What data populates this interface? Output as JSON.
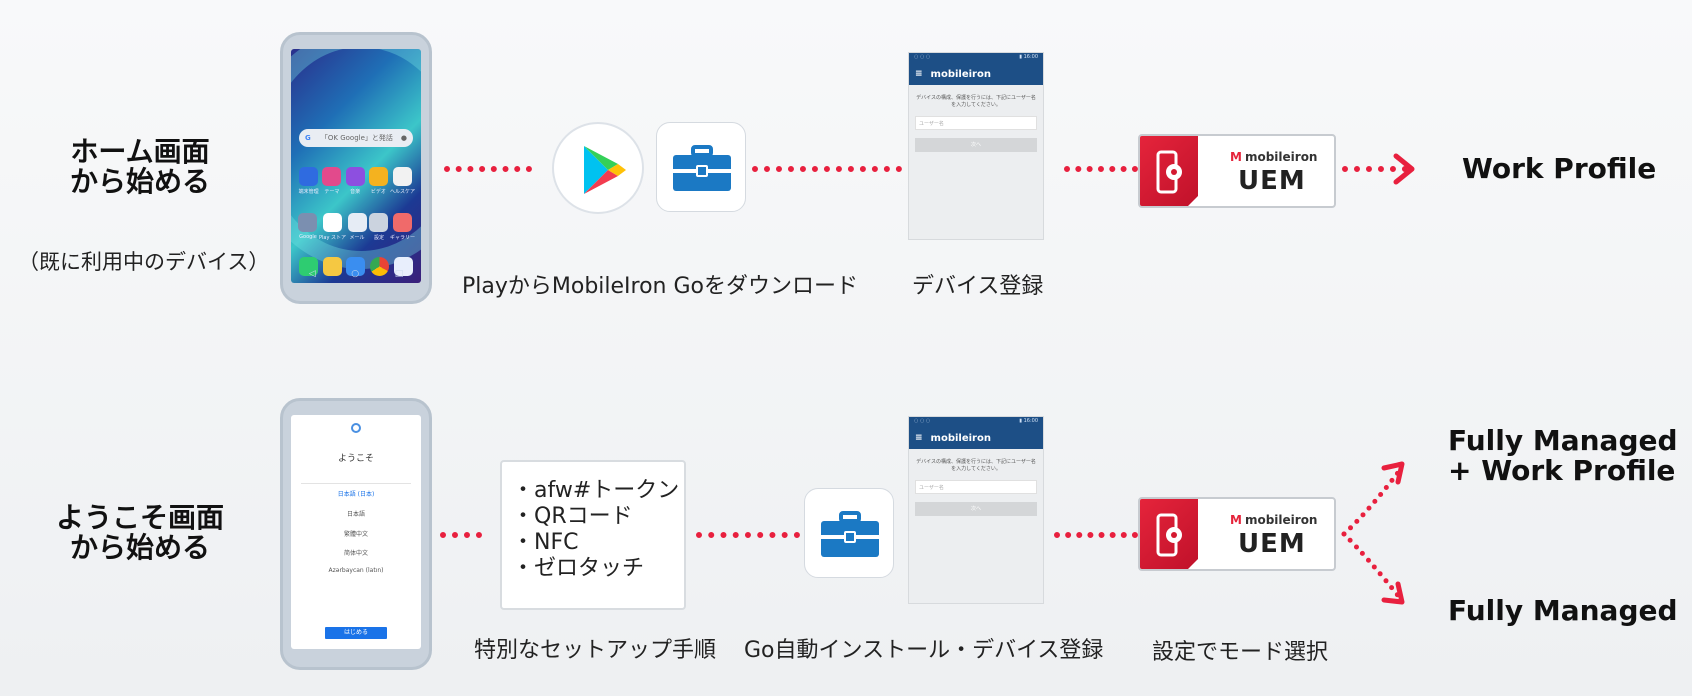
{
  "colors": {
    "accent": "#e8203e",
    "mobileiron_blue": "#1d4f86",
    "uem_red": "#e5243b"
  },
  "row1": {
    "title_line1": "ホーム画面",
    "title_line2": "から始める",
    "subtitle": "（既に利用中のデバイス）",
    "phone": {
      "search_placeholder": "「OK Google」と発話",
      "apps": [
        "端末管理",
        "テーマ",
        "音楽",
        "ビデオ",
        "ヘルスケア",
        "Google",
        "Play ストア",
        "メール",
        "設定",
        "ギャラリー"
      ]
    },
    "step1_caption": "PlayからMobileIron Goをダウンロード",
    "step2_caption": "デバイス登録",
    "result": "Work Profile"
  },
  "row2": {
    "title_line1": "ようこそ画面",
    "title_line2": "から始める",
    "phone": {
      "welcome_title": "ようこそ",
      "languages": [
        "日本語 (日本)",
        "日本語",
        "繁體中文",
        "简体中文",
        "Azərbaycan (latın)"
      ],
      "start_button": "はじめる"
    },
    "tokens": [
      "・afw#トークン",
      "・QRコード",
      "・NFC",
      "・ゼロタッチ"
    ],
    "step1_caption": "特別なセットアップ手順",
    "step2_caption": "Go自動インストール・デバイス登録",
    "step3_caption": "設定でモード選択",
    "result_a_line1": "Fully Managed",
    "result_a_line2": "+ Work Profile",
    "result_b": "Fully Managed"
  },
  "enroll_screen": {
    "brand": "mobileiron",
    "instructions": "デバイスの構成、保護を行うには、下記にユーザー名を入力してください。",
    "username_placeholder": "ユーザー名",
    "next_button": "次へ"
  },
  "uem": {
    "brand": "mobileiron",
    "product": "UEM"
  },
  "icons": {
    "play_store": "google-play-icon",
    "mobileiron_go": "briefcase-icon",
    "uem": "gear-phone-icon"
  }
}
